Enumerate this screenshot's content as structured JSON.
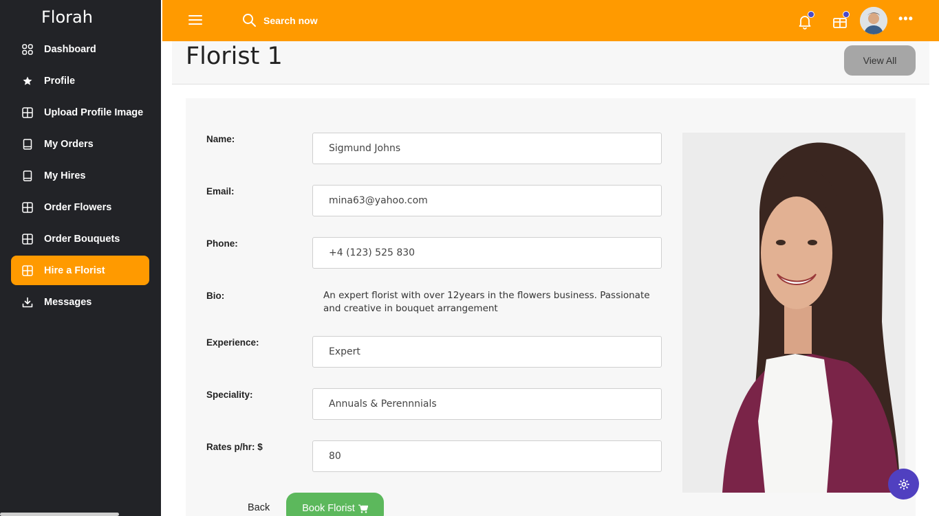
{
  "sidebar": {
    "brand": "Florah",
    "items": [
      {
        "label": "Dashboard",
        "icon": "dashboard-icon"
      },
      {
        "label": "Profile",
        "icon": "star-icon"
      },
      {
        "label": "Upload Profile Image",
        "icon": "grid-icon"
      },
      {
        "label": "My Orders",
        "icon": "book-icon"
      },
      {
        "label": "My Hires",
        "icon": "book-icon"
      },
      {
        "label": "Order Flowers",
        "icon": "grid-icon"
      },
      {
        "label": "Order Bouquets",
        "icon": "grid-icon"
      },
      {
        "label": "Hire a Florist",
        "icon": "grid-icon",
        "active": true
      },
      {
        "label": "Messages",
        "icon": "download-icon"
      }
    ]
  },
  "topbar": {
    "search_placeholder": "Search now",
    "accent": "#ff9a00"
  },
  "page": {
    "title": "Florist 1",
    "view_all_label": "View All"
  },
  "form": {
    "name_label": "Name:",
    "name_value": "Sigmund Johns",
    "email_label": "Email:",
    "email_value": "mina63@yahoo.com",
    "phone_label": "Phone:",
    "phone_value": "+4 (123) 525 830",
    "bio_label": "Bio:",
    "bio_value": "An expert florist with over 12years in the flowers business. Passionate and creative in bouquet arrangement",
    "experience_label": "Experience:",
    "experience_value": "Expert",
    "speciality_label": "Speciality:",
    "speciality_value": "Annuals & Perennnials",
    "rate_label": "Rates p/hr: $",
    "rate_value": "80"
  },
  "actions": {
    "back_label": "Back",
    "book_label": "Book Florist"
  }
}
